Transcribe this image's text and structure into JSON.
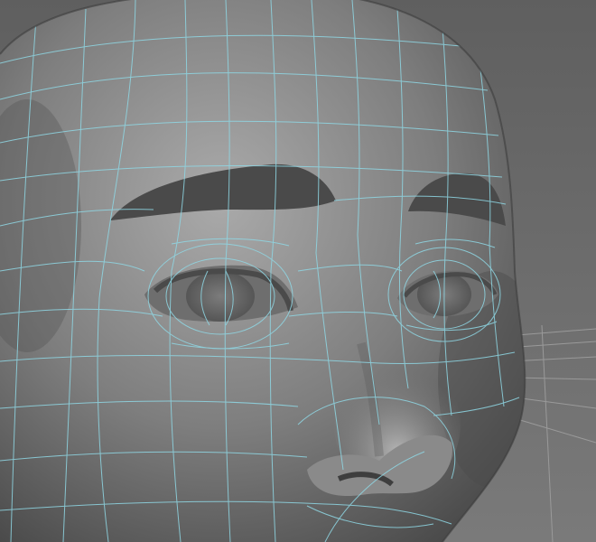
{
  "viewport": {
    "background_top": "#5f5f5f",
    "background_bottom": "#7a7a7a"
  },
  "model": {
    "skin_color": "#7e7e7e",
    "skin_highlight": "#aaaaaa",
    "skin_shadow": "#4a4a4a",
    "brow_color": "#4a4a4a",
    "eye_color": "#6a6a6a",
    "wireframe_color": "#8fd7e4"
  },
  "grid": {
    "line_color": "#9a9a9a"
  }
}
